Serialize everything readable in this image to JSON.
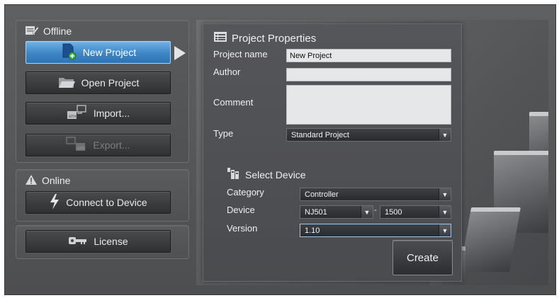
{
  "left": {
    "offline": {
      "title": "Offline",
      "new_project": "New Project",
      "open_project": "Open Project",
      "import": "Import...",
      "export": "Export..."
    },
    "online": {
      "title": "Online",
      "connect": "Connect to Device"
    },
    "license": "License"
  },
  "props": {
    "title": "Project Properties",
    "project_name_label": "Project name",
    "project_name_value": "New Project",
    "author_label": "Author",
    "author_value": "",
    "comment_label": "Comment",
    "comment_value": "",
    "type_label": "Type",
    "type_value": "Standard Project",
    "select_device_title": "Select Device",
    "category_label": "Category",
    "category_value": "Controller",
    "device_label": "Device",
    "device_value": "NJ501",
    "device_separator": "-",
    "device_model_value": "1500",
    "version_label": "Version",
    "version_value": "1.10",
    "create_label": "Create"
  },
  "colors": {
    "active_button": "#3d86c6",
    "panel": "#55565a",
    "field": "#e6e7e9"
  }
}
